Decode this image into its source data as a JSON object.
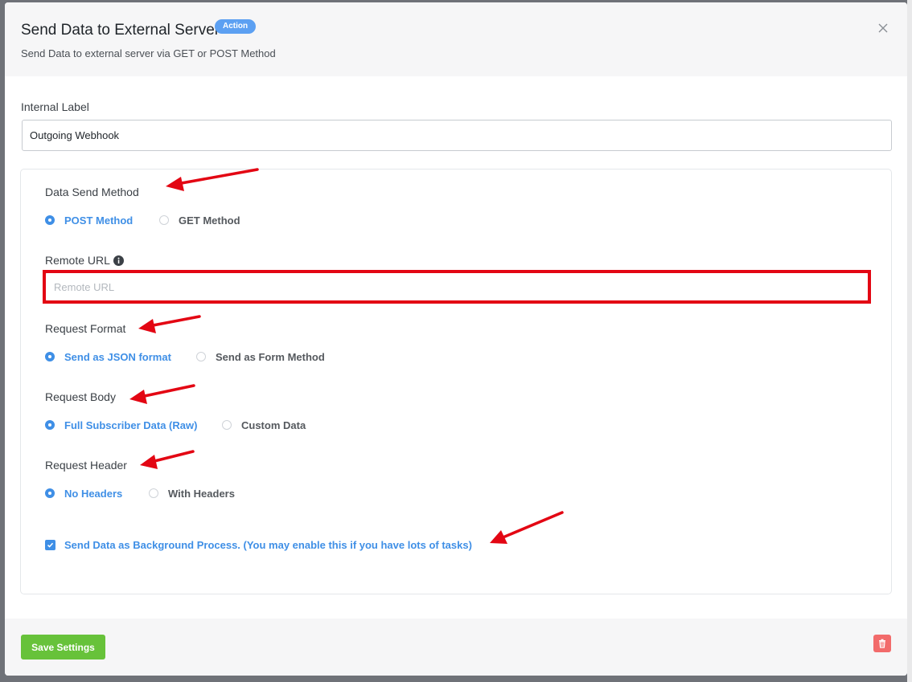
{
  "modal": {
    "title": "Send Data to External Server",
    "badge": "Action",
    "subtitle": "Send Data to external server via GET or POST Method"
  },
  "internal_label": {
    "label": "Internal Label",
    "value": "Outgoing Webhook"
  },
  "data_send_method": {
    "label": "Data Send Method",
    "options": [
      {
        "label": "POST Method",
        "selected": true
      },
      {
        "label": "GET Method",
        "selected": false
      }
    ]
  },
  "remote_url": {
    "label": "Remote URL",
    "placeholder": "Remote URL",
    "value": ""
  },
  "request_format": {
    "label": "Request Format",
    "options": [
      {
        "label": "Send as JSON format",
        "selected": true
      },
      {
        "label": "Send as Form Method",
        "selected": false
      }
    ]
  },
  "request_body": {
    "label": "Request Body",
    "options": [
      {
        "label": "Full Subscriber Data (Raw)",
        "selected": true
      },
      {
        "label": "Custom Data",
        "selected": false
      }
    ]
  },
  "request_header": {
    "label": "Request Header",
    "options": [
      {
        "label": "No Headers",
        "selected": true
      },
      {
        "label": "With Headers",
        "selected": false
      }
    ]
  },
  "background_process": {
    "label": "Send Data as Background Process. (You may enable this if you have lots of tasks)",
    "checked": true
  },
  "footer": {
    "save_label": "Save Settings"
  },
  "colors": {
    "accent": "#3f8fe6",
    "badge": "#5ca0f2",
    "save": "#67c23a",
    "delete": "#f26b6b",
    "annotation": "#e30613"
  },
  "icons": {
    "close": "close-icon",
    "info": "info-icon",
    "delete": "trash-icon",
    "check": "checkmark-icon"
  }
}
